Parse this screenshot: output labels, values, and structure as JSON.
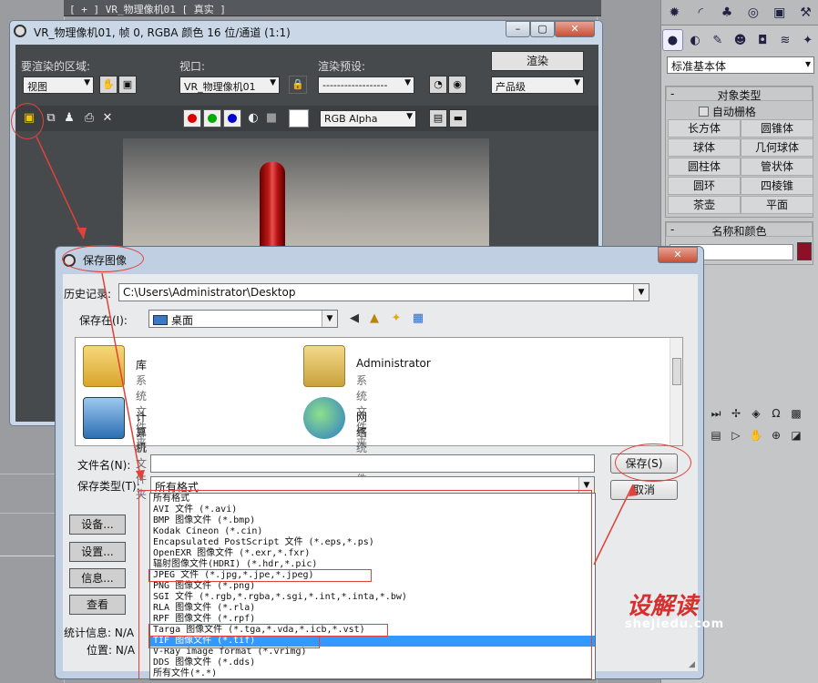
{
  "viewport": {
    "label": "[ + ] VR_物理像机01 [ 真实 ]"
  },
  "command_panel": {
    "primitive_select": "标准基本体",
    "object_type": {
      "title": "对象类型",
      "autogrid": "自动栅格",
      "buttons": [
        "长方体",
        "圆锥体",
        "球体",
        "几何球体",
        "圆柱体",
        "管状体",
        "圆环",
        "四棱锥",
        "茶壶",
        "平面"
      ]
    },
    "name_color": {
      "title": "名称和颜色"
    },
    "color_swatch": "#8e1026"
  },
  "frame_window": {
    "title": "VR_物理像机01, 帧 0, RGBA 颜色 16 位/通道 (1:1)",
    "area_label": "要渲染的区域:",
    "area_value": "视图",
    "viewport_label": "视口:",
    "viewport_value": "VR_物理像机01",
    "preset_label": "渲染预设:",
    "preset_value": "------------------",
    "render_button": "渲染",
    "quality_value": "产品级",
    "channel_value": "RGB Alpha",
    "side_buttons": [
      "设备...",
      "设置...",
      "信息...",
      "查看"
    ],
    "stats_label": "统计信息: N/A",
    "pos_label": "位置: N/A"
  },
  "save_dialog": {
    "title": "保存图像",
    "history_label": "历史记录:",
    "history_value": "C:\\Users\\Administrator\\Desktop",
    "savein_label": "保存在(I):",
    "savein_value": "桌面",
    "files": [
      {
        "name": "库",
        "type": "系统文件夹",
        "icon": "library-icon"
      },
      {
        "name": "Administrator",
        "type": "系统文件夹",
        "icon": "user-folder-icon"
      },
      {
        "name": "计算机",
        "type": "系统文件夹",
        "icon": "computer-icon"
      },
      {
        "name": "网络",
        "type": "系统文件夹",
        "icon": "network-icon"
      }
    ],
    "filename_label": "文件名(N):",
    "filename_value": "",
    "filetype_label": "保存类型(T):",
    "filetype_value": "所有格式",
    "save_button": "保存(S)",
    "cancel_button": "取消",
    "format_options": [
      "所有格式",
      "AVI 文件 (*.avi)",
      "BMP 图像文件 (*.bmp)",
      "Kodak Cineon (*.cin)",
      "Encapsulated PostScript 文件 (*.eps,*.ps)",
      "OpenEXR 图像文件 (*.exr,*.fxr)",
      "辐射图像文件(HDRI) (*.hdr,*.pic)",
      "JPEG 文件 (*.jpg,*.jpe,*.jpeg)",
      "PNG 图像文件 (*.png)",
      "SGI 文件 (*.rgb,*.rgba,*.sgi,*.int,*.inta,*.bw)",
      "RLA 图像文件 (*.rla)",
      "RPF 图像文件 (*.rpf)",
      "Targa 图像文件 (*.tga,*.vda,*.icb,*.vst)",
      "TIF 图像文件 (*.tif)",
      "V-Ray image format (*.vrimg)",
      "DDS 图像文件 (*.dds)",
      "所有文件(*.*)"
    ],
    "selected_index": 13
  },
  "watermark": {
    "text": "设解读",
    "url": "shejiedu.com"
  },
  "colors": {
    "annotation": "#e0413a",
    "highlight": "#3399ff"
  }
}
